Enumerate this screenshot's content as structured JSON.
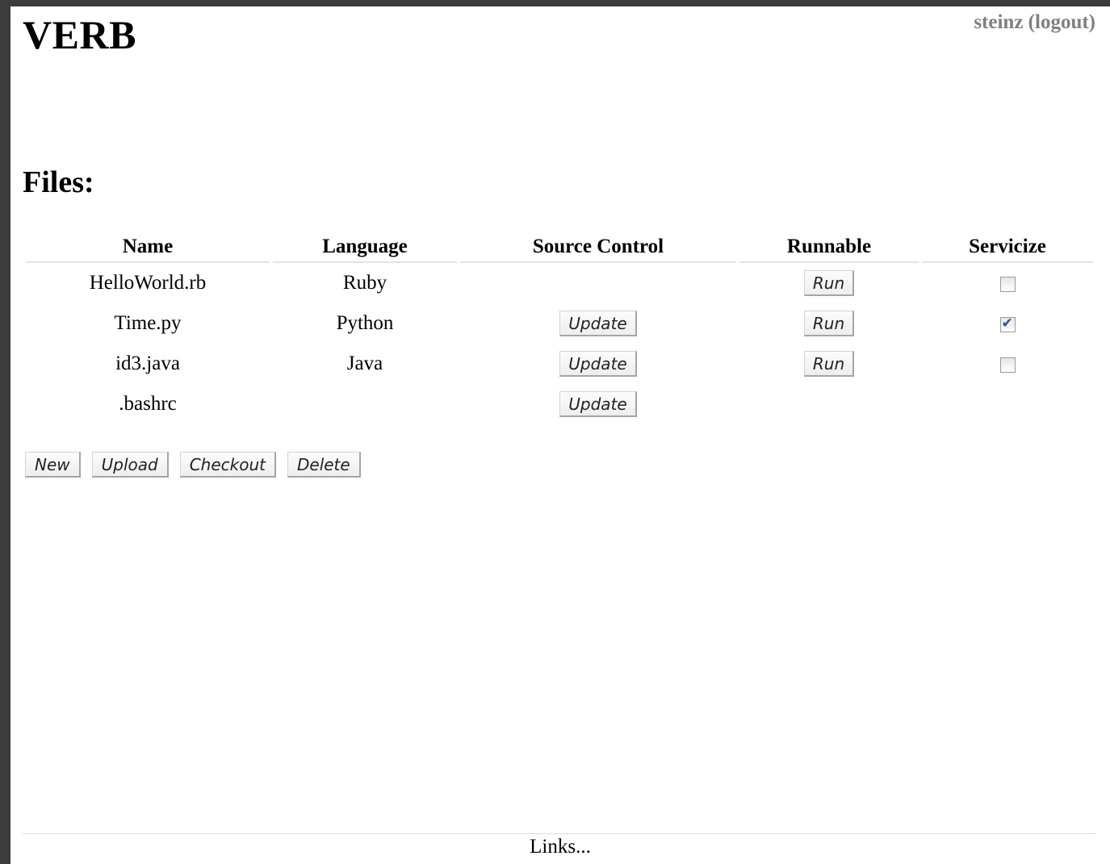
{
  "header": {
    "app_title": "VERB",
    "username": "steinz",
    "logout_label": "(logout)"
  },
  "files_section": {
    "title": "Files:",
    "columns": [
      "Name",
      "Language",
      "Source Control",
      "Runnable",
      "Servicize"
    ],
    "rows": [
      {
        "name": "HelloWorld.rb",
        "language": "Ruby",
        "source_control_label": "",
        "run_label": "Run",
        "runnable": true,
        "servicize_checked": false
      },
      {
        "name": "Time.py",
        "language": "Python",
        "source_control_label": "Update",
        "run_label": "Run",
        "runnable": true,
        "servicize_checked": true
      },
      {
        "name": "id3.java",
        "language": "Java",
        "source_control_label": "Update",
        "run_label": "Run",
        "runnable": true,
        "servicize_checked": false
      },
      {
        "name": ".bashrc",
        "language": "",
        "source_control_label": "Update",
        "run_label": "",
        "runnable": false,
        "servicize_checked": null
      }
    ]
  },
  "actions": {
    "new_label": "New",
    "upload_label": "Upload",
    "checkout_label": "Checkout",
    "delete_label": "Delete"
  },
  "footer": {
    "links_label": "Links..."
  }
}
